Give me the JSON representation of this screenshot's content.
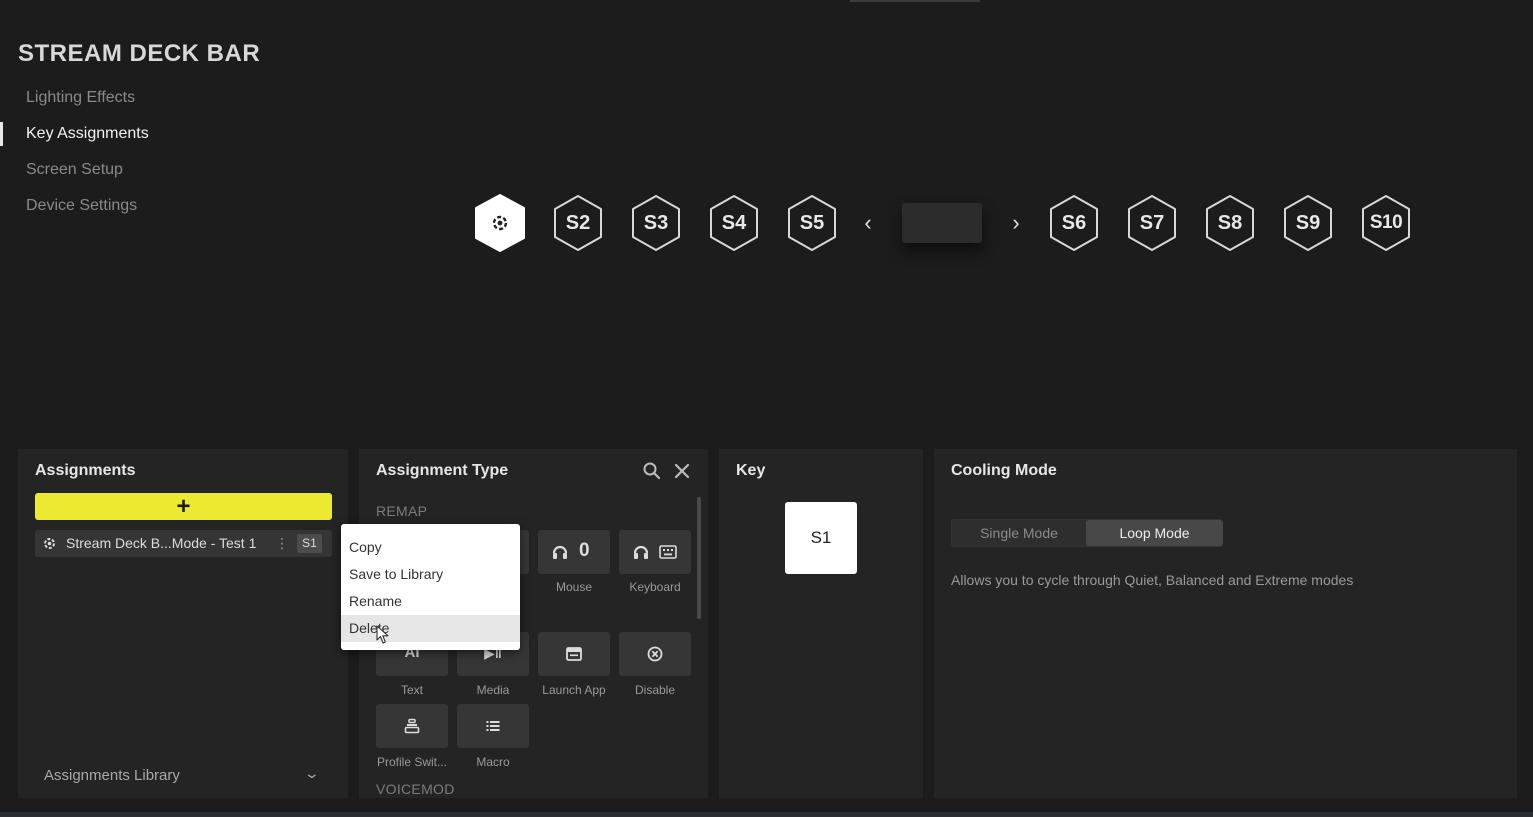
{
  "page": {
    "title": "STREAM DECK BAR"
  },
  "nav": {
    "items": [
      {
        "label": "Lighting Effects",
        "active": false
      },
      {
        "label": "Key Assignments",
        "active": true
      },
      {
        "label": "Screen Setup",
        "active": false
      },
      {
        "label": "Device Settings",
        "active": false
      }
    ]
  },
  "keys": {
    "left": [
      "S2",
      "S3",
      "S4",
      "S5"
    ],
    "right": [
      "S6",
      "S7",
      "S8",
      "S9",
      "S10"
    ],
    "first_icon": "gear-icon",
    "prev_arrow": "‹",
    "next_arrow": "›"
  },
  "assignments": {
    "title": "Assignments",
    "add_label": "+",
    "row": {
      "name": "Stream Deck B...Mode - Test 1",
      "menu": "⋮",
      "key": "S1",
      "icon": "gear-icon"
    },
    "library_label": "Assignments Library"
  },
  "assignment_type": {
    "title": "Assignment Type",
    "section_remap": "REMAP",
    "section_voicemod": "VOICEMOD",
    "tiles": [
      {
        "caption": "Mouse",
        "icon": "mouse-icon",
        "glyph": "0"
      },
      {
        "caption": "Keyboard",
        "icon": "keyboard-icon"
      },
      {
        "caption": "Text",
        "icon": "text-icon",
        "glyph": "AI"
      },
      {
        "caption": "Media",
        "icon": "media-icon",
        "glyph": "▶‖"
      },
      {
        "caption": "Launch App",
        "icon": "launch-app-icon"
      },
      {
        "caption": "Disable",
        "icon": "disable-icon"
      },
      {
        "caption": "Profile Swit...",
        "icon": "profile-switch-icon"
      },
      {
        "caption": "Macro",
        "icon": "macro-icon"
      }
    ]
  },
  "key_panel": {
    "title": "Key",
    "key_label": "S1"
  },
  "cooling": {
    "title": "Cooling Mode",
    "modes": [
      "Single Mode",
      "Loop Mode"
    ],
    "selected": "Loop Mode",
    "description": "Allows you to cycle through Quiet, Balanced and Extreme modes"
  },
  "context_menu": {
    "items": [
      "Copy",
      "Save to Library",
      "Rename",
      "Delete"
    ],
    "hovered": "Delete"
  },
  "colors": {
    "accent_yellow": "#ecea30",
    "background": "#1c1c1c",
    "panel": "#242424"
  }
}
